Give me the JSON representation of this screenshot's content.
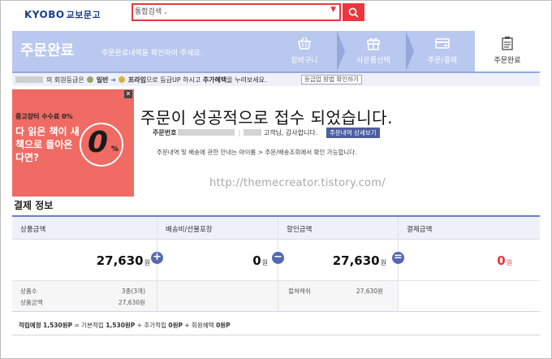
{
  "header": {
    "logo_en": "KYOBO",
    "logo_ko": "교보문고",
    "search_scope": "통합검색",
    "search_value": ""
  },
  "steps_bar": {
    "title": "주문완료",
    "description": "주문완료내역을 확인하여 주세요.",
    "steps": [
      {
        "label": "장바구니",
        "icon": "basket-icon"
      },
      {
        "label": "사은품선택",
        "icon": "gift-icon"
      },
      {
        "label": "주문/결제",
        "icon": "card-icon"
      },
      {
        "label": "주문완료",
        "icon": "clipboard-icon"
      }
    ]
  },
  "grade": {
    "text_prefix": "의 회원등급은",
    "grade_current": "일반",
    "grade_next": "프라임",
    "text_mid": "으로 등급UP 하시고",
    "benefit": "추가혜택",
    "text_suffix": "을 누려보세요.",
    "guide_button": "등급업 방법 확인하기"
  },
  "ad": {
    "close": "✕",
    "headline": "중고장터 수수료 0%",
    "copy": "다 읽은 책이 새 책으로 돌아온다면?",
    "big_number": "0",
    "percent": "%"
  },
  "confirmation": {
    "title": "주문이 성공적으로 접수 되었습니다.",
    "order_label": "주문번호",
    "thanks": "고객님, 감사합니다.",
    "detail_button": "주문내역 상세보기",
    "notice": "주문내역 및 배송에 관한 안내는 마이룸 > 주문/배송조회에서 확인 가능합니다."
  },
  "watermark": "http://themecreator.tistory.com/",
  "payment": {
    "title": "결제 정보",
    "columns": [
      {
        "header": "상품금액",
        "amount": "27,630",
        "unit": "원"
      },
      {
        "header": "배송비/선물포장",
        "amount": "0",
        "unit": "원"
      },
      {
        "header": "할인금액",
        "amount": "27,630",
        "unit": "원"
      },
      {
        "header": "결제금액",
        "amount": "0",
        "unit": "원"
      }
    ],
    "operators": [
      "+",
      "−",
      "="
    ],
    "details": {
      "qty_label": "상품수",
      "qty_value": "3종(3개)",
      "amount_label": "상품금액",
      "amount_value": "27,630원",
      "discount_label": "컬쳐캐쉬",
      "discount_value": "27,630원"
    },
    "points_label": "적립예정",
    "points_value": "1,530원P",
    "points_formula": "= 기본적립",
    "points_basic": "1,530원P",
    "points_extra_label": "+ 추가적립",
    "points_extra": "0원P",
    "points_member_label": "+ 회원혜택",
    "points_member": "0원P"
  },
  "colors": {
    "accent_red": "#e8383d",
    "step_blue": "#b9c8ee",
    "button_navy": "#4d5fa0",
    "ad_red": "#ef6b63"
  }
}
